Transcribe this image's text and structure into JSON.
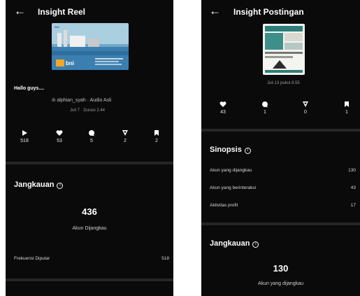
{
  "left": {
    "title": "Insight Reel",
    "thumbnail": {
      "top_text": "BNI",
      "label": "bni"
    },
    "caption": "Hallo guys....",
    "audio": "alphian_syah · Audio Asli",
    "meta": "Juli 7 · Durasi 2.44",
    "stats": [
      {
        "icon": "play-icon",
        "value": "518"
      },
      {
        "icon": "heart-icon",
        "value": "53"
      },
      {
        "icon": "comment-icon",
        "value": "5"
      },
      {
        "icon": "share-icon",
        "value": "2"
      },
      {
        "icon": "bookmark-icon",
        "value": "2"
      }
    ],
    "reach": {
      "title": "Jangkauan",
      "number": "436",
      "label": "Akun Dijangkau",
      "row_label": "Frekuensi Diputar",
      "row_value": "518"
    }
  },
  "right": {
    "title": "Insight Postingan",
    "meta": "Juli 13 pukul 8.55",
    "stats": [
      {
        "icon": "heart-icon",
        "value": "43"
      },
      {
        "icon": "comment-icon",
        "value": "1"
      },
      {
        "icon": "share-icon",
        "value": "0"
      },
      {
        "icon": "bookmark-icon",
        "value": "1"
      }
    ],
    "synopsis": {
      "title": "Sinopsis",
      "rows": [
        {
          "label": "Akun yang dijangkau",
          "value": "130"
        },
        {
          "label": "Akun yang berinteraksi",
          "value": "43"
        },
        {
          "label": "Aktivitas profil",
          "value": "17"
        }
      ]
    },
    "reach": {
      "title": "Jangkauan",
      "number": "130",
      "label": "Akun yang dijangkau"
    }
  }
}
